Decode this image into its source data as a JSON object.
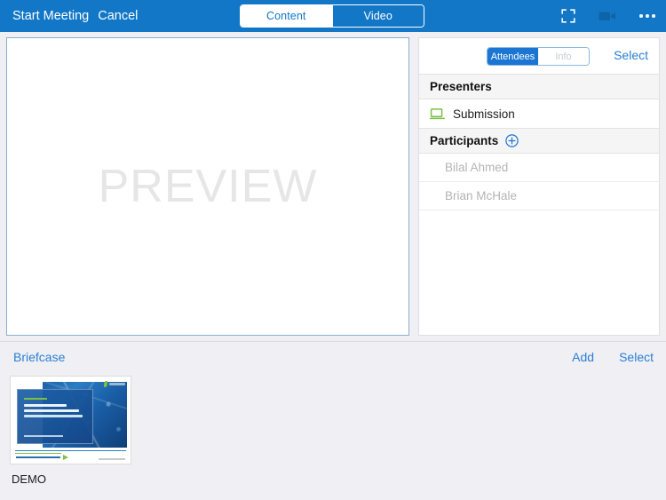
{
  "topbar": {
    "start_meeting_label": "Start Meeting",
    "cancel_label": "Cancel",
    "mode_tabs": [
      {
        "label": "Content",
        "selected": false
      },
      {
        "label": "Video",
        "selected": true
      }
    ],
    "icons": {
      "fullscreen": "fullscreen-icon",
      "camera": "video-camera-icon",
      "more": "more-options-icon"
    },
    "background_color": "#1277c7"
  },
  "preview": {
    "watermark": "PREVIEW"
  },
  "panel": {
    "tabs": [
      {
        "label": "Attendees",
        "selected": true
      },
      {
        "label": "Info",
        "selected": false
      }
    ],
    "select_label": "Select",
    "sections": [
      {
        "title": "Presenters",
        "has_add": false,
        "rows": [
          {
            "name": "Submission",
            "icon": "laptop-icon",
            "icon_color": "#7ac143",
            "dim": false
          }
        ]
      },
      {
        "title": "Participants",
        "has_add": true,
        "add_icon": "plus-circle-icon",
        "rows": [
          {
            "name": "Bilal Ahmed",
            "icon": null,
            "dim": true
          },
          {
            "name": "Brian McHale",
            "icon": null,
            "dim": true
          }
        ]
      }
    ]
  },
  "briefcase": {
    "title": "Briefcase",
    "add_label": "Add",
    "select_label": "Select",
    "items": [
      {
        "label": "DEMO",
        "slide_title_line1": "Suggestions for",
        "slide_title_line2": "Building Up Dual Model",
        "slide_title_line3": "供应及打推广模式的讨论建议"
      }
    ]
  },
  "colors": {
    "accent_blue": "#1277c7",
    "link_blue": "#2b7fd4",
    "green": "#7ac143",
    "page_bg": "#efeff4"
  }
}
